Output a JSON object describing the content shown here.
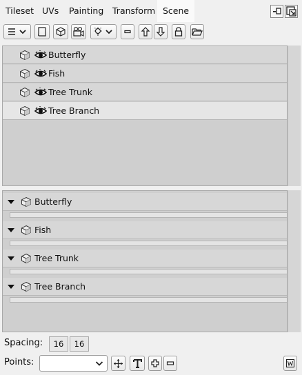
{
  "tabs": [
    {
      "label": "Tileset",
      "active": false
    },
    {
      "label": "UVs",
      "active": false
    },
    {
      "label": "Painting",
      "active": false
    },
    {
      "label": "Transform",
      "active": false
    },
    {
      "label": "Scene",
      "active": true
    }
  ],
  "window_buttons": [
    "minimize-icon",
    "restore-icon"
  ],
  "toolbar": {
    "buttons": [
      "menu-dropdown-icon",
      "scroll-icon",
      "cube-icon",
      "camera-icon",
      "light-dropdown-icon",
      "minus-icon",
      "arrow-up-icon",
      "arrow-down-icon",
      "lock-icon",
      "folder-icon"
    ]
  },
  "scene_list": [
    {
      "label": "Butterfly",
      "visible": true,
      "selected": false
    },
    {
      "label": "Fish",
      "visible": true,
      "selected": false
    },
    {
      "label": "Tree Trunk",
      "visible": true,
      "selected": false
    },
    {
      "label": "Tree Branch",
      "visible": true,
      "selected": true
    }
  ],
  "groups": [
    {
      "label": "Butterfly",
      "expanded": true
    },
    {
      "label": "Fish",
      "expanded": true
    },
    {
      "label": "Tree Trunk",
      "expanded": true
    },
    {
      "label": "Tree Branch",
      "expanded": true
    }
  ],
  "spacing": {
    "label": "Spacing:",
    "x": "16",
    "y": "16"
  },
  "points": {
    "label": "Points:",
    "value": ""
  },
  "colors": {
    "panel": "#cfcfcf",
    "row": "#d7d7d7",
    "selected_row": "#e6e6e6",
    "background": "#f0f0f0"
  }
}
